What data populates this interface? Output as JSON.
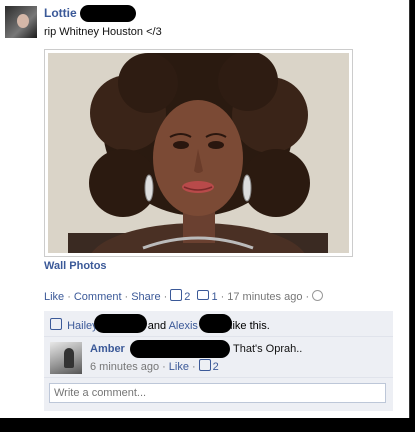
{
  "post": {
    "author_name": "Lottie",
    "status_text": "rip Whitney Houston </3",
    "album_label": "Wall Photos"
  },
  "actions": {
    "like_label": "Like",
    "comment_label": "Comment",
    "share_label": "Share",
    "like_count": "2",
    "comment_count": "1",
    "timestamp": "17 minutes ago",
    "sep": "·"
  },
  "likes": {
    "name1": "Hailey",
    "and_text": "and",
    "name2": "Alexis",
    "suffix": "like this."
  },
  "comment": {
    "author": "Amber",
    "text": "That's Oprah..",
    "timestamp": "6 minutes ago",
    "like_label": "Like",
    "like_count": "2"
  },
  "write_comment": {
    "placeholder": "Write a comment..."
  },
  "icons": {
    "like_icon": "thumbs-up-icon",
    "comment_icon": "speech-bubble-icon",
    "privacy_icon": "globe-icon"
  },
  "colors": {
    "link": "#3b5998",
    "muted": "#777777",
    "panel": "#edeff4"
  }
}
